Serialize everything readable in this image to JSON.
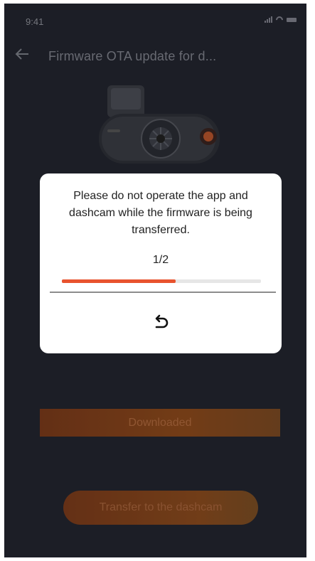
{
  "status": {
    "time": "9:41"
  },
  "header": {
    "title": "Firmware OTA update for d..."
  },
  "buttons": {
    "downloaded": "Downloaded",
    "transfer": "Transfer to the dashcam"
  },
  "modal": {
    "message": "Please do not operate the app and dashcam while the firmware is being transferred.",
    "progress_text": "1/2",
    "progress_fraction": 0.57
  },
  "colors": {
    "background": "#23252f",
    "accent": "#e8532e",
    "modal_bg": "#ffffff"
  },
  "icons": {
    "back": "arrow-left-icon",
    "undo": "undo-icon"
  }
}
